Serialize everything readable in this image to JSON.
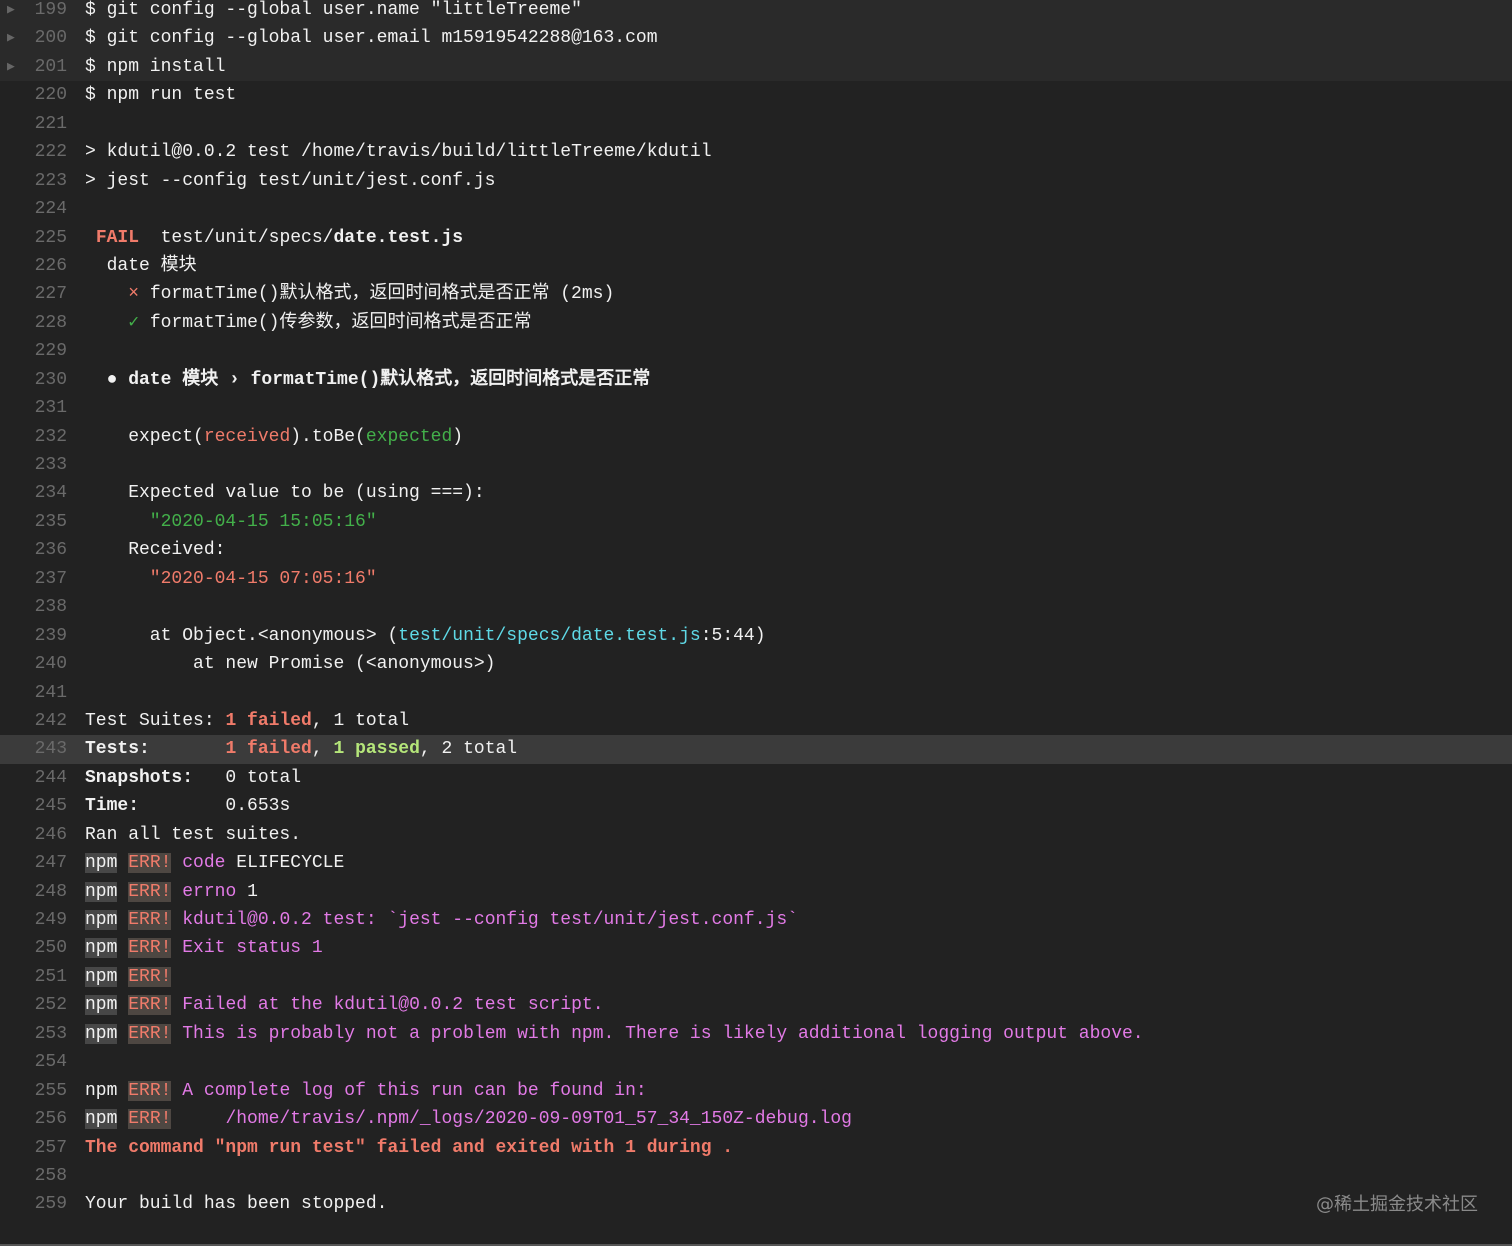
{
  "watermark": "@稀土掘金技术社区",
  "lines": [
    {
      "n": "199",
      "fold": true,
      "seg": [
        {
          "t": "$ git config --global user.name \"littleTreeme\"",
          "c": ""
        }
      ]
    },
    {
      "n": "200",
      "fold": true,
      "seg": [
        {
          "t": "$ git config --global user.email m15919542288@163.com",
          "c": ""
        }
      ]
    },
    {
      "n": "201",
      "fold": true,
      "seg": [
        {
          "t": "$ npm install",
          "c": ""
        }
      ]
    },
    {
      "n": "220",
      "seg": [
        {
          "t": "$ npm run test",
          "c": ""
        }
      ]
    },
    {
      "n": "221",
      "seg": []
    },
    {
      "n": "222",
      "seg": [
        {
          "t": "> kdutil@0.0.2 test /home/travis/build/littleTreeme/kdutil",
          "c": ""
        }
      ]
    },
    {
      "n": "223",
      "seg": [
        {
          "t": "> jest --config test/unit/jest.conf.js",
          "c": ""
        }
      ]
    },
    {
      "n": "224",
      "seg": []
    },
    {
      "n": "225",
      "seg": [
        {
          "t": " ",
          "c": ""
        },
        {
          "t": "FAIL",
          "c": "redb"
        },
        {
          "t": "  test/unit/specs/",
          "c": ""
        },
        {
          "t": "date.test.js",
          "c": "b"
        }
      ]
    },
    {
      "n": "226",
      "seg": [
        {
          "t": "  date 模块",
          "c": ""
        }
      ]
    },
    {
      "n": "227",
      "seg": [
        {
          "t": "    ",
          "c": ""
        },
        {
          "t": "×",
          "c": "red"
        },
        {
          "t": " formatTime()默认格式，返回时间格式是否正常 (2ms)",
          "c": ""
        }
      ]
    },
    {
      "n": "228",
      "seg": [
        {
          "t": "    ",
          "c": ""
        },
        {
          "t": "✓",
          "c": "chk"
        },
        {
          "t": " formatTime()传参数，返回时间格式是否正常",
          "c": ""
        }
      ]
    },
    {
      "n": "229",
      "seg": []
    },
    {
      "n": "230",
      "seg": [
        {
          "t": "  ● date 模块 › formatTime()默认格式，返回时间格式是否正常",
          "c": "b"
        }
      ]
    },
    {
      "n": "231",
      "seg": []
    },
    {
      "n": "232",
      "seg": [
        {
          "t": "    expect(",
          "c": ""
        },
        {
          "t": "received",
          "c": "red"
        },
        {
          "t": ").toBe(",
          "c": ""
        },
        {
          "t": "expected",
          "c": "grn"
        },
        {
          "t": ")",
          "c": ""
        }
      ]
    },
    {
      "n": "233",
      "seg": []
    },
    {
      "n": "234",
      "seg": [
        {
          "t": "    Expected value to be (using ===):",
          "c": ""
        }
      ]
    },
    {
      "n": "235",
      "seg": [
        {
          "t": "      \"2020-04-15 15:05:16\"",
          "c": "grn"
        }
      ]
    },
    {
      "n": "236",
      "seg": [
        {
          "t": "    Received:",
          "c": ""
        }
      ]
    },
    {
      "n": "237",
      "seg": [
        {
          "t": "      \"2020-04-15 07:05:16\"",
          "c": "red"
        }
      ]
    },
    {
      "n": "238",
      "seg": []
    },
    {
      "n": "239",
      "seg": [
        {
          "t": "      at Object.<anonymous> (",
          "c": ""
        },
        {
          "t": "test/unit/specs/date.test.js",
          "c": "cyan"
        },
        {
          "t": ":5:44)",
          "c": ""
        }
      ]
    },
    {
      "n": "240",
      "seg": [
        {
          "t": "          at new Promise (<anonymous>)",
          "c": ""
        }
      ]
    },
    {
      "n": "241",
      "seg": []
    },
    {
      "n": "242",
      "seg": [
        {
          "t": "Test Suites: ",
          "c": ""
        },
        {
          "t": "1 failed",
          "c": "redb"
        },
        {
          "t": ", 1 total",
          "c": ""
        }
      ]
    },
    {
      "n": "243",
      "hl": true,
      "seg": [
        {
          "t": "Tests:",
          "c": "b"
        },
        {
          "t": "       ",
          "c": ""
        },
        {
          "t": "1 failed",
          "c": "redb"
        },
        {
          "t": ", ",
          "c": ""
        },
        {
          "t": "1 passed",
          "c": "grnb"
        },
        {
          "t": ", 2 total",
          "c": ""
        }
      ]
    },
    {
      "n": "244",
      "seg": [
        {
          "t": "Snapshots:",
          "c": "b"
        },
        {
          "t": "   0 total",
          "c": ""
        }
      ]
    },
    {
      "n": "245",
      "seg": [
        {
          "t": "Time:",
          "c": "b"
        },
        {
          "t": "        0.653s",
          "c": ""
        }
      ]
    },
    {
      "n": "246",
      "seg": [
        {
          "t": "Ran all test suites.",
          "c": ""
        }
      ]
    },
    {
      "n": "247",
      "seg": [
        {
          "t": "npm",
          "c": "npm"
        },
        {
          "t": " ",
          "c": ""
        },
        {
          "t": "ERR!",
          "c": "err"
        },
        {
          "t": " ",
          "c": ""
        },
        {
          "t": "code",
          "c": "mag"
        },
        {
          "t": " ELIFECYCLE",
          "c": ""
        }
      ]
    },
    {
      "n": "248",
      "seg": [
        {
          "t": "npm",
          "c": "npm"
        },
        {
          "t": " ",
          "c": ""
        },
        {
          "t": "ERR!",
          "c": "err"
        },
        {
          "t": " ",
          "c": ""
        },
        {
          "t": "errno",
          "c": "mag"
        },
        {
          "t": " 1",
          "c": ""
        }
      ]
    },
    {
      "n": "249",
      "seg": [
        {
          "t": "npm",
          "c": "npm"
        },
        {
          "t": " ",
          "c": ""
        },
        {
          "t": "ERR!",
          "c": "err"
        },
        {
          "t": " kdutil@0.0.2 test: `jest --config test/unit/jest.conf.js`",
          "c": "mag"
        }
      ]
    },
    {
      "n": "250",
      "seg": [
        {
          "t": "npm",
          "c": "npm"
        },
        {
          "t": " ",
          "c": ""
        },
        {
          "t": "ERR!",
          "c": "err"
        },
        {
          "t": " Exit status 1",
          "c": "mag"
        }
      ]
    },
    {
      "n": "251",
      "seg": [
        {
          "t": "npm",
          "c": "npm"
        },
        {
          "t": " ",
          "c": ""
        },
        {
          "t": "ERR!",
          "c": "err"
        }
      ]
    },
    {
      "n": "252",
      "seg": [
        {
          "t": "npm",
          "c": "npm"
        },
        {
          "t": " ",
          "c": ""
        },
        {
          "t": "ERR!",
          "c": "err"
        },
        {
          "t": " Failed at the kdutil@0.0.2 test script.",
          "c": "mag"
        }
      ]
    },
    {
      "n": "253",
      "seg": [
        {
          "t": "npm",
          "c": "npm"
        },
        {
          "t": " ",
          "c": ""
        },
        {
          "t": "ERR!",
          "c": "err"
        },
        {
          "t": " This is probably not a problem with npm. There is likely additional logging output above.",
          "c": "mag"
        }
      ]
    },
    {
      "n": "254",
      "seg": []
    },
    {
      "n": "255",
      "seg": [
        {
          "t": "npm",
          "c": ""
        },
        {
          "t": " ",
          "c": ""
        },
        {
          "t": "ERR!",
          "c": "err"
        },
        {
          "t": " A complete log of this run can be found in:",
          "c": "mag"
        }
      ]
    },
    {
      "n": "256",
      "seg": [
        {
          "t": "npm",
          "c": "npm"
        },
        {
          "t": " ",
          "c": ""
        },
        {
          "t": "ERR!",
          "c": "err"
        },
        {
          "t": "     /home/travis/.npm/_logs/2020-09-09T01_57_34_150Z-debug.log",
          "c": "mag"
        }
      ]
    },
    {
      "n": "257",
      "seg": [
        {
          "t": "The command \"npm run test\" failed and exited with 1 during .",
          "c": "redb"
        }
      ]
    },
    {
      "n": "258",
      "seg": []
    },
    {
      "n": "259",
      "seg": [
        {
          "t": "Your build has been stopped.",
          "c": ""
        }
      ]
    }
  ]
}
